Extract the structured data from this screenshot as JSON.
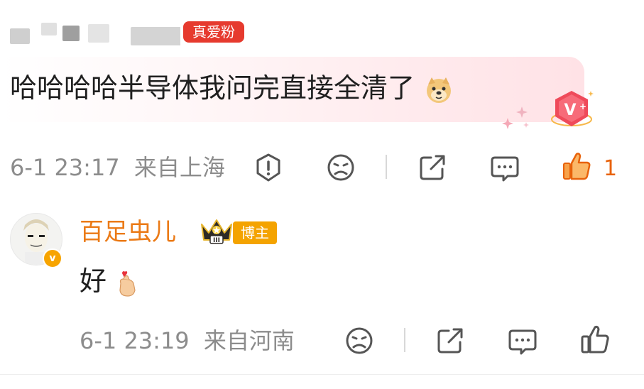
{
  "top_comment": {
    "badge_text": "真爱粉",
    "text": "哈哈哈哈半导体我问完直接全清了",
    "timestamp": "6-1 23:17",
    "location": "来自上海",
    "like_count": "1",
    "icons": {
      "report": "exclamation-shield-icon",
      "dislike": "frown-face-icon",
      "share": "share-box-icon",
      "comment": "comment-bubble-icon",
      "like": "thumbs-up-icon"
    }
  },
  "reply": {
    "username": "百足虫儿",
    "role_badge": "博主",
    "text": "好",
    "timestamp": "6-1 23:19",
    "location": "来自河南"
  },
  "colors": {
    "accent_orange": "#eb7a16",
    "badge_red": "#e63a2e",
    "bozhu_gold": "#f4a300",
    "meta_gray": "#8c8c8c"
  }
}
